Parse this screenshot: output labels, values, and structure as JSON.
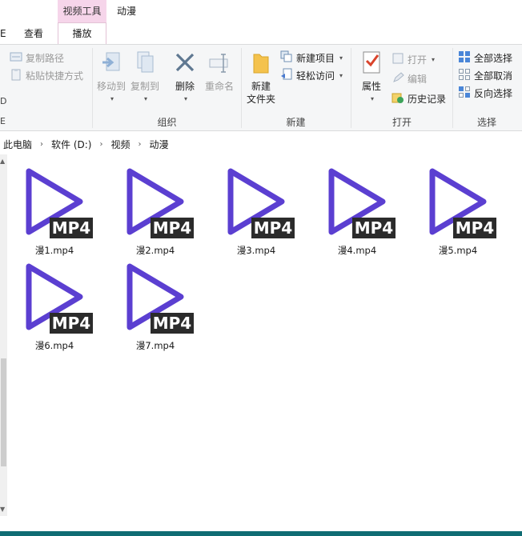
{
  "window": {
    "contextual_tab": "视频工具",
    "title": "动漫"
  },
  "ribbon_tabs": {
    "cut_off": "E",
    "view": "查看",
    "play": "播放"
  },
  "ribbon": {
    "organize": {
      "copy_path": "复制路径",
      "paste_shortcut": "粘贴快捷方式",
      "move_to": "移动到",
      "copy_to": "复制到",
      "delete": "删除",
      "rename": "重命名",
      "group_label": "组织"
    },
    "new": {
      "new_folder_line1": "新建",
      "new_folder_line2": "文件夹",
      "new_item": "新建项目",
      "easy_access": "轻松访问",
      "group_label": "新建"
    },
    "open": {
      "properties": "属性",
      "open": "打开",
      "edit": "编辑",
      "history": "历史记录",
      "group_label": "打开"
    },
    "select": {
      "select_all": "全部选择",
      "select_none": "全部取消",
      "invert": "反向选择",
      "group_label": "选择"
    },
    "left_fragment": "E",
    "left_fragment2": "D"
  },
  "breadcrumb": [
    "此电脑",
    "软件 (D:)",
    "视频",
    "动漫"
  ],
  "files": [
    {
      "name": "漫1.mp4",
      "badge": "MP4"
    },
    {
      "name": "漫2.mp4",
      "badge": "MP4"
    },
    {
      "name": "漫3.mp4",
      "badge": "MP4"
    },
    {
      "name": "漫4.mp4",
      "badge": "MP4"
    },
    {
      "name": "漫5.mp4",
      "badge": "MP4"
    },
    {
      "name": "漫6.mp4",
      "badge": "MP4"
    },
    {
      "name": "漫7.mp4",
      "badge": "MP4"
    }
  ],
  "colors": {
    "play_icon": "#5b3fd1",
    "badge_bg": "#2b2b2b",
    "context_tab": "#f6d5ea"
  }
}
